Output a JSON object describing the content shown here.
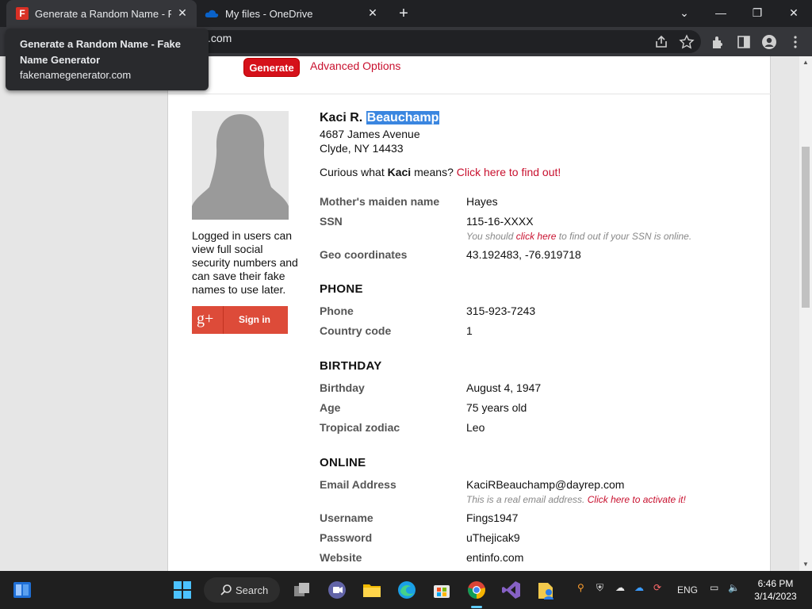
{
  "browser": {
    "tabs": [
      {
        "title": "Generate a Random Name - Fake Name Generator",
        "active": true
      },
      {
        "title": "My files - OneDrive",
        "active": false
      }
    ],
    "url_visible": ".com",
    "tooltip": {
      "title": "Generate a Random Name - Fake Name Generator",
      "url": "fakenamegenerator.com"
    }
  },
  "page": {
    "generate_label": "Generate",
    "advanced_label": "Advanced Options",
    "login_text": "Logged in users can view full social security numbers and can save their fake names to use later.",
    "gplus_label": "Sign in",
    "gplus_logo": "g+",
    "name_first": "Kaci R.",
    "name_last": "Beauchamp",
    "address_line1": "4687 James Avenue",
    "address_line2": "Clyde, NY 14433",
    "curious_prefix": "Curious what",
    "curious_name": "Kaci",
    "curious_suffix": "means?",
    "curious_link": "Click here to find out!",
    "identity": {
      "maiden_label": "Mother's maiden name",
      "maiden_value": "Hayes",
      "ssn_label": "SSN",
      "ssn_value": "115-16-XXXX",
      "ssn_note_prefix": "You should",
      "ssn_note_link": "click here",
      "ssn_note_suffix": "to find out if your SSN is online.",
      "geo_label": "Geo coordinates",
      "geo_value": "43.192483, -76.919718"
    },
    "phone": {
      "heading": "PHONE",
      "phone_label": "Phone",
      "phone_value": "315-923-7243",
      "cc_label": "Country code",
      "cc_value": "1"
    },
    "birthday": {
      "heading": "BIRTHDAY",
      "bday_label": "Birthday",
      "bday_value": "August 4, 1947",
      "age_label": "Age",
      "age_value": "75 years old",
      "zodiac_label": "Tropical zodiac",
      "zodiac_value": "Leo"
    },
    "online": {
      "heading": "ONLINE",
      "email_label": "Email Address",
      "email_value": "KaciRBeauchamp@dayrep.com",
      "email_note_prefix": "This is a real email address.",
      "email_note_link": "Click here to activate it!",
      "user_label": "Username",
      "user_value": "Fings1947",
      "pass_label": "Password",
      "pass_value": "uThejicak9",
      "web_label": "Website",
      "web_value": "entinfo.com"
    }
  },
  "taskbar": {
    "search_label": "Search",
    "lang": "ENG",
    "time": "6:46 PM",
    "date": "3/14/2023"
  }
}
